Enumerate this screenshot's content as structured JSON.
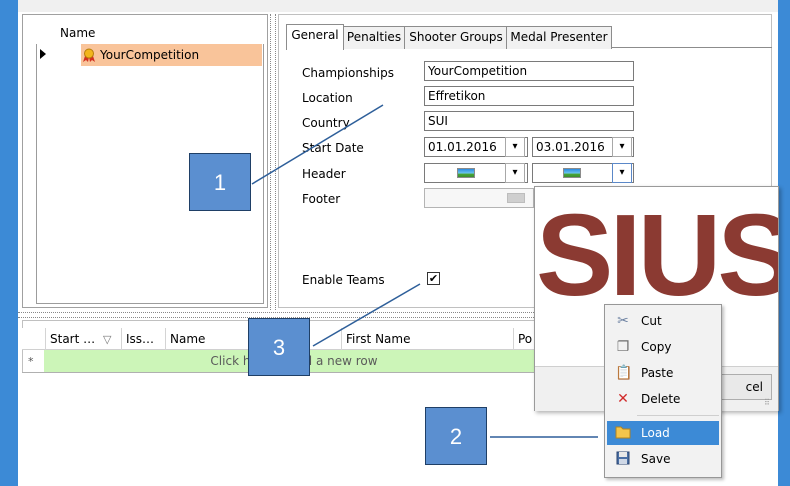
{
  "tree": {
    "header": "Name",
    "item": "YourCompetition"
  },
  "tabs": [
    {
      "label": "General"
    },
    {
      "label": "Penalties"
    },
    {
      "label": "Shooter Groups"
    },
    {
      "label": "Medal Presenter"
    }
  ],
  "form": {
    "championships_label": "Championships",
    "championships_value": "YourCompetition",
    "location_label": "Location",
    "location_value": "Effretikon",
    "country_label": "Country",
    "country_value": "SUI",
    "start_date_label": "Start Date",
    "start_date_value": "01.01.2016",
    "end_date_value": "03.01.2016",
    "header_label": "Header",
    "footer_label": "Footer",
    "enable_teams_label": "Enable Teams",
    "enable_teams_checked": "✔"
  },
  "grid": {
    "columns": [
      "Start …",
      "Iss…",
      "Name",
      "First Name",
      "Po"
    ],
    "new_row_text": "Click here to add a new row",
    "new_row_marker": "*"
  },
  "popup": {
    "logo_text": "SIUS",
    "cancel_label": "cel"
  },
  "context_menu": {
    "items": [
      {
        "label": "Cut",
        "icon": "scissors-icon"
      },
      {
        "label": "Copy",
        "icon": "copy-icon"
      },
      {
        "label": "Paste",
        "icon": "paste-icon"
      },
      {
        "label": "Delete",
        "icon": "delete-icon"
      },
      {
        "label": "Load",
        "icon": "folder-icon"
      },
      {
        "label": "Save",
        "icon": "floppy-icon"
      }
    ]
  },
  "callouts": [
    "1",
    "2",
    "3"
  ],
  "colors": {
    "frame": "#3c8ad6",
    "selection": "#f9c49a",
    "new_row": "#ccf5b8",
    "callout": "#5b8fd0",
    "logo": "#8b3a32"
  }
}
